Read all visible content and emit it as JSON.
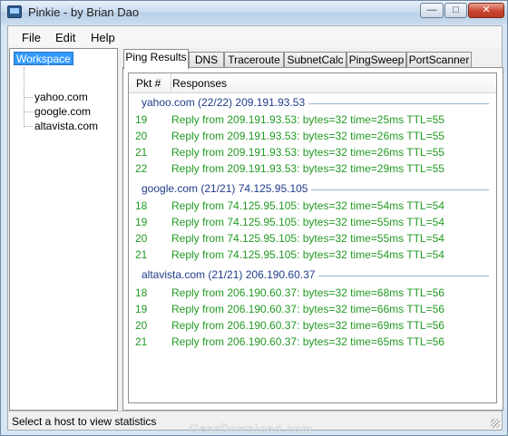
{
  "window": {
    "title": "Pinkie - by Brian Dao",
    "controls": {
      "minimize": "—",
      "maximize": "□",
      "close": "✕"
    }
  },
  "menu": [
    "File",
    "Edit",
    "Help"
  ],
  "tree": {
    "root": "Workspace",
    "children": [
      "yahoo.com",
      "google.com",
      "altavista.com"
    ]
  },
  "tabs": [
    "Ping Results",
    "DNS",
    "Traceroute",
    "SubnetCalc",
    "PingSweep",
    "PortScanner"
  ],
  "results": {
    "columns": [
      "Pkt #",
      "Responses"
    ],
    "groups": [
      {
        "title": "yahoo.com (22/22) 209.191.93.53",
        "rows": [
          {
            "pkt": "19",
            "resp": "Reply from 209.191.93.53: bytes=32 time=25ms TTL=55"
          },
          {
            "pkt": "20",
            "resp": "Reply from 209.191.93.53: bytes=32 time=26ms TTL=55"
          },
          {
            "pkt": "21",
            "resp": "Reply from 209.191.93.53: bytes=32 time=26ms TTL=55"
          },
          {
            "pkt": "22",
            "resp": "Reply from 209.191.93.53: bytes=32 time=29ms TTL=55"
          }
        ]
      },
      {
        "title": "google.com (21/21) 74.125.95.105",
        "rows": [
          {
            "pkt": "18",
            "resp": "Reply from 74.125.95.105: bytes=32 time=54ms TTL=54"
          },
          {
            "pkt": "19",
            "resp": "Reply from 74.125.95.105: bytes=32 time=55ms TTL=54"
          },
          {
            "pkt": "20",
            "resp": "Reply from 74.125.95.105: bytes=32 time=55ms TTL=54"
          },
          {
            "pkt": "21",
            "resp": "Reply from 74.125.95.105: bytes=32 time=54ms TTL=54"
          }
        ]
      },
      {
        "title": "altavista.com (21/21) 206.190.60.37",
        "rows": [
          {
            "pkt": "18",
            "resp": "Reply from 206.190.60.37: bytes=32 time=68ms TTL=56"
          },
          {
            "pkt": "19",
            "resp": "Reply from 206.190.60.37: bytes=32 time=66ms TTL=56"
          },
          {
            "pkt": "20",
            "resp": "Reply from 206.190.60.37: bytes=32 time=69ms TTL=56"
          },
          {
            "pkt": "21",
            "resp": "Reply from 206.190.60.37: bytes=32 time=65ms TTL=56"
          }
        ]
      }
    ]
  },
  "status": "Select a host to view statistics",
  "watermark": "GearDownload.com",
  "colors": {
    "reply_text": "#229a22",
    "group_title": "#1f3c8a",
    "selection": "#3399ff"
  }
}
